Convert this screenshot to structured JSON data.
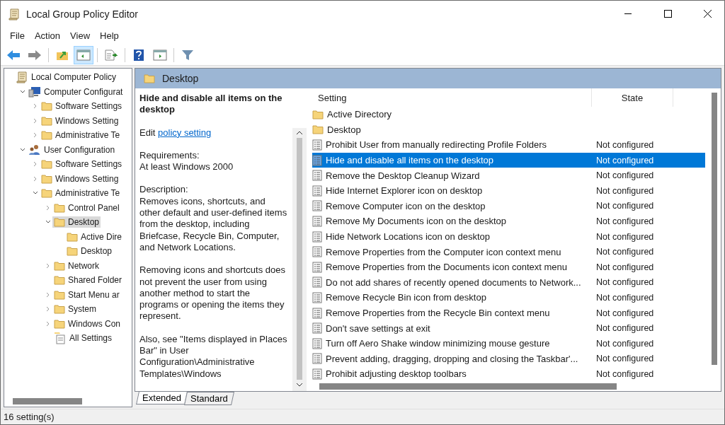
{
  "window": {
    "title": "Local Group Policy Editor"
  },
  "menu": [
    "File",
    "Action",
    "View",
    "Help"
  ],
  "toolbar": [
    {
      "kind": "back",
      "selected": false
    },
    {
      "kind": "forward",
      "selected": false
    },
    {
      "kind": "up",
      "selected": false
    },
    {
      "kind": "tree",
      "selected": true
    },
    {
      "kind": "export",
      "selected": false
    },
    {
      "kind": "help",
      "selected": false
    },
    {
      "kind": "pane",
      "selected": false
    },
    {
      "kind": "filter",
      "selected": false
    }
  ],
  "tree": [
    {
      "label": "Local Computer Policy",
      "kind": "policy",
      "selected": false,
      "children": [
        {
          "label": "Computer Configurat",
          "kind": "computer",
          "expanded": true,
          "selected": false,
          "children": [
            {
              "label": "Software Settings",
              "kind": "folder",
              "expanded": false,
              "selected": false
            },
            {
              "label": "Windows Setting",
              "kind": "folder",
              "expanded": false,
              "selected": false
            },
            {
              "label": "Administrative Te",
              "kind": "folder",
              "expanded": false,
              "selected": false
            }
          ]
        },
        {
          "label": "User Configuration",
          "kind": "user",
          "expanded": true,
          "selected": false,
          "children": [
            {
              "label": "Software Settings",
              "kind": "folder",
              "expanded": false,
              "selected": false
            },
            {
              "label": "Windows Setting",
              "kind": "folder",
              "expanded": false,
              "selected": false
            },
            {
              "label": "Administrative Te",
              "kind": "folder",
              "expanded": true,
              "selected": false,
              "children": [
                {
                  "label": "Control Panel",
                  "kind": "folder",
                  "expanded": false,
                  "selected": false
                },
                {
                  "label": "Desktop",
                  "kind": "folder",
                  "expanded": true,
                  "selected": true,
                  "children": [
                    {
                      "label": "Active Dire",
                      "kind": "folder",
                      "selected": false
                    },
                    {
                      "label": "Desktop",
                      "kind": "folder",
                      "selected": false
                    }
                  ]
                },
                {
                  "label": "Network",
                  "kind": "folder",
                  "expanded": false,
                  "selected": false
                },
                {
                  "label": "Shared Folder",
                  "kind": "folder",
                  "selected": false
                },
                {
                  "label": "Start Menu ar",
                  "kind": "folder",
                  "expanded": false,
                  "selected": false
                },
                {
                  "label": "System",
                  "kind": "folder",
                  "expanded": false,
                  "selected": false
                },
                {
                  "label": "Windows Con",
                  "kind": "folder",
                  "expanded": false,
                  "selected": false
                },
                {
                  "label": "All Settings",
                  "kind": "all",
                  "selected": false
                }
              ]
            }
          ]
        }
      ]
    }
  ],
  "header": {
    "title": "Desktop"
  },
  "details": {
    "title": "Hide and disable all items on the desktop",
    "edit_prefix": "Edit",
    "edit_link": "policy setting",
    "paragraphs": [
      [
        "Requirements:",
        "At least Windows 2000"
      ],
      [
        "Description:",
        "Removes icons, shortcuts, and other default and user-defined items from the desktop, including Briefcase, Recycle Bin, Computer, and Network Locations."
      ],
      [
        "Removing icons and shortcuts does not prevent the user from using another method to start the programs or opening the items they represent."
      ],
      [
        "Also, see \"Items displayed in Places Bar\" in User Configuration\\Administrative Templates\\Windows"
      ]
    ]
  },
  "columns": [
    "Setting",
    "State"
  ],
  "settings": [
    {
      "kind": "folder",
      "name": "Active Directory",
      "selected": false
    },
    {
      "kind": "folder",
      "name": "Desktop",
      "selected": false
    },
    {
      "kind": "policy",
      "name": "Prohibit User from manually redirecting Profile Folders",
      "state": "Not configured",
      "selected": false
    },
    {
      "kind": "policy",
      "name": "Hide and disable all items on the desktop",
      "state": "Not configured",
      "selected": true
    },
    {
      "kind": "policy",
      "name": "Remove the Desktop Cleanup Wizard",
      "state": "Not configured",
      "selected": false
    },
    {
      "kind": "policy",
      "name": "Hide Internet Explorer icon on desktop",
      "state": "Not configured",
      "selected": false
    },
    {
      "kind": "policy",
      "name": "Remove Computer icon on the desktop",
      "state": "Not configured",
      "selected": false
    },
    {
      "kind": "policy",
      "name": "Remove My Documents icon on the desktop",
      "state": "Not configured",
      "selected": false
    },
    {
      "kind": "policy",
      "name": "Hide Network Locations icon on desktop",
      "state": "Not configured",
      "selected": false
    },
    {
      "kind": "policy",
      "name": "Remove Properties from the Computer icon context menu",
      "state": "Not configured",
      "selected": false
    },
    {
      "kind": "policy",
      "name": "Remove Properties from the Documents icon context menu",
      "state": "Not configured",
      "selected": false
    },
    {
      "kind": "policy",
      "name": "Do not add shares of recently opened documents to Network...",
      "state": "Not configured",
      "selected": false
    },
    {
      "kind": "policy",
      "name": "Remove Recycle Bin icon from desktop",
      "state": "Not configured",
      "selected": false
    },
    {
      "kind": "policy",
      "name": "Remove Properties from the Recycle Bin context menu",
      "state": "Not configured",
      "selected": false
    },
    {
      "kind": "policy",
      "name": "Don't save settings at exit",
      "state": "Not configured",
      "selected": false
    },
    {
      "kind": "policy",
      "name": "Turn off Aero Shake window minimizing mouse gesture",
      "state": "Not configured",
      "selected": false
    },
    {
      "kind": "policy",
      "name": "Prevent adding, dragging, dropping and closing the Taskbar'...",
      "state": "Not configured",
      "selected": false
    },
    {
      "kind": "policy",
      "name": "Prohibit adjusting desktop toolbars",
      "state": "Not configured",
      "selected": false
    }
  ],
  "tabs": [
    {
      "label": "Extended",
      "selected": true
    },
    {
      "label": "Standard",
      "selected": false
    }
  ],
  "status_bar": "16 setting(s)"
}
